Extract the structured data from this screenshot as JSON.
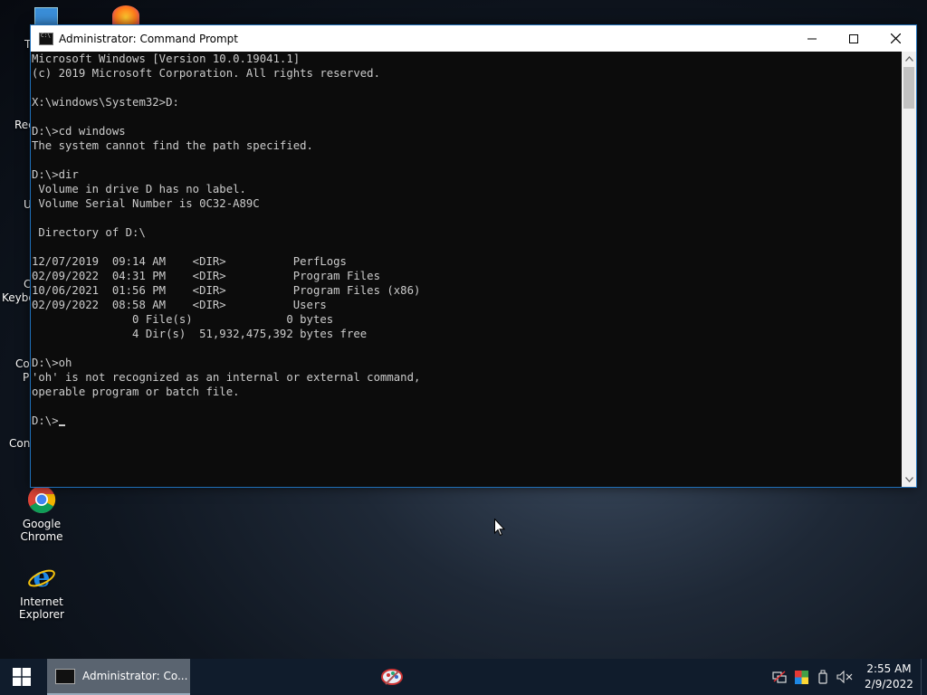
{
  "desktop": {
    "icons": [
      {
        "label": "Google Chrome"
      },
      {
        "label": "Internet Explorer"
      }
    ],
    "partial_labels": [
      "T",
      "Rec",
      "U",
      "C",
      "Keybo",
      "Co",
      "P",
      "Con"
    ]
  },
  "window": {
    "title": "Administrator: Command Prompt",
    "console_lines": [
      "Microsoft Windows [Version 10.0.19041.1]",
      "(c) 2019 Microsoft Corporation. All rights reserved.",
      "",
      "X:\\windows\\System32>D:",
      "",
      "D:\\>cd windows",
      "The system cannot find the path specified.",
      "",
      "D:\\>dir",
      " Volume in drive D has no label.",
      " Volume Serial Number is 0C32-A89C",
      "",
      " Directory of D:\\",
      "",
      "12/07/2019  09:14 AM    <DIR>          PerfLogs",
      "02/09/2022  04:31 PM    <DIR>          Program Files",
      "10/06/2021  01:56 PM    <DIR>          Program Files (x86)",
      "02/09/2022  08:58 AM    <DIR>          Users",
      "               0 File(s)              0 bytes",
      "               4 Dir(s)  51,932,475,392 bytes free",
      "",
      "D:\\>oh",
      "'oh' is not recognized as an internal or external command,",
      "operable program or batch file.",
      "",
      "D:\\>"
    ]
  },
  "taskbar": {
    "active_item": "Administrator: Co...",
    "clock_time": "2:55 AM",
    "clock_date": "2/9/2022"
  },
  "colors": {
    "console_bg": "#0c0c0c",
    "console_fg": "#cccccc",
    "window_border": "#1f6fb8",
    "taskbar_bg": "#101c2c"
  }
}
